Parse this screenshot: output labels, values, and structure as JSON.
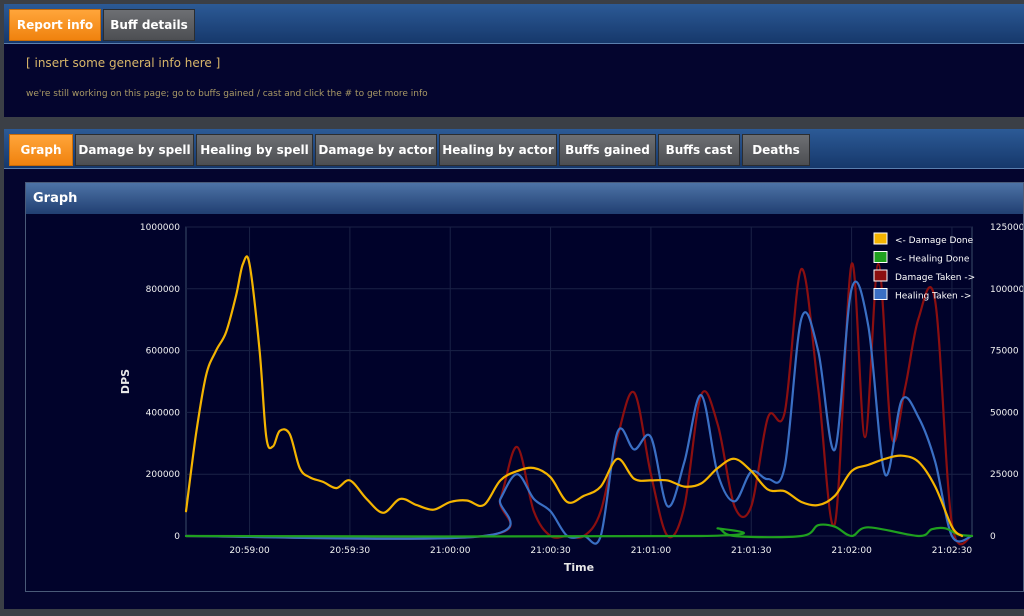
{
  "report_tabs": [
    "Report info",
    "Buff details"
  ],
  "info": {
    "title": "[ insert some general info here ]",
    "subtitle": "we're still working on this page; go to buffs gained / cast and click the # to get more info"
  },
  "section_tabs": [
    "Graph",
    "Damage by spell",
    "Healing by spell",
    "Damage by actor",
    "Healing by actor",
    "Buffs gained",
    "Buffs cast",
    "Deaths"
  ],
  "graph_panel": {
    "title": "Graph"
  },
  "colors": {
    "active_tab": "#f59118",
    "tab": "#5d5f63",
    "panel_bg": "#04052e",
    "header_blue": "#244a80"
  },
  "chart_data": {
    "type": "line",
    "xlabel": "Time",
    "ylabel": "DPS",
    "x_ticks": [
      "20:59:00",
      "20:59:30",
      "21:00:00",
      "21:00:30",
      "21:01:00",
      "21:01:30",
      "21:02:00",
      "21:02:30"
    ],
    "xlim": [
      "20:58:41",
      "21:02:36"
    ],
    "ylim_left": [
      0,
      1000000
    ],
    "ylim_right": [
      0,
      125000
    ],
    "y_ticks_left": [
      "0",
      "200000",
      "400000",
      "600000",
      "800000",
      "1000000"
    ],
    "y_ticks_right": [
      "0",
      "25000",
      "50000",
      "75000",
      "100000",
      "125000"
    ],
    "legend_position": "top-right",
    "grid": true,
    "series": [
      {
        "name": "<- Damage Done",
        "axis": "left",
        "color": "#f4b400",
        "x": [
          "20:58:41",
          "20:58:44",
          "20:58:47",
          "20:58:50",
          "20:58:53",
          "20:58:56",
          "20:58:58",
          "20:59:00",
          "20:59:03",
          "20:59:05",
          "20:59:07",
          "20:59:09",
          "20:59:12",
          "20:59:15",
          "20:59:18",
          "20:59:22",
          "20:59:26",
          "20:59:30",
          "20:59:35",
          "20:59:40",
          "20:59:45",
          "20:59:50",
          "20:59:55",
          "21:00:00",
          "21:00:05",
          "21:00:10",
          "21:00:15",
          "21:00:20",
          "21:00:25",
          "21:00:30",
          "21:00:35",
          "21:00:40",
          "21:00:45",
          "21:00:50",
          "21:00:55",
          "21:01:00",
          "21:01:05",
          "21:01:10",
          "21:01:15",
          "21:01:20",
          "21:01:25",
          "21:01:30",
          "21:01:35",
          "21:01:40",
          "21:01:45",
          "21:01:50",
          "21:01:55",
          "21:02:00",
          "21:02:05",
          "21:02:10",
          "21:02:15",
          "21:02:20",
          "21:02:25",
          "21:02:30",
          "21:02:33"
        ],
        "y": [
          80000,
          330000,
          520000,
          600000,
          660000,
          780000,
          880000,
          880000,
          600000,
          320000,
          290000,
          340000,
          330000,
          220000,
          190000,
          175000,
          155000,
          180000,
          120000,
          75000,
          120000,
          100000,
          85000,
          110000,
          115000,
          100000,
          180000,
          210000,
          220000,
          190000,
          110000,
          130000,
          160000,
          250000,
          185000,
          180000,
          180000,
          160000,
          170000,
          220000,
          250000,
          210000,
          150000,
          145000,
          110000,
          100000,
          130000,
          210000,
          230000,
          250000,
          260000,
          240000,
          160000,
          30000,
          0
        ]
      },
      {
        "name": "<- Healing Done",
        "axis": "left",
        "color": "#1fa01f",
        "x": [
          "20:58:41",
          "21:01:15",
          "21:01:20",
          "21:01:25",
          "21:01:45",
          "21:01:50",
          "21:01:55",
          "21:02:00",
          "21:02:05",
          "21:02:20",
          "21:02:24",
          "21:02:28",
          "21:02:32",
          "21:02:36"
        ],
        "y": [
          0,
          0,
          25000,
          0,
          0,
          35000,
          30000,
          0,
          28000,
          0,
          22000,
          25000,
          5000,
          0
        ]
      },
      {
        "name": "Damage Taken ->",
        "axis": "right",
        "color": "#8b0f10",
        "x": [
          "20:58:41",
          "21:00:10",
          "21:00:15",
          "21:00:20",
          "21:00:25",
          "21:00:30",
          "21:00:35",
          "21:00:40",
          "21:00:45",
          "21:00:50",
          "21:00:55",
          "21:01:00",
          "21:01:05",
          "21:01:10",
          "21:01:15",
          "21:01:20",
          "21:01:25",
          "21:01:30",
          "21:01:35",
          "21:01:40",
          "21:01:45",
          "21:01:50",
          "21:01:55",
          "21:02:00",
          "21:02:04",
          "21:02:08",
          "21:02:12",
          "21:02:16",
          "21:02:20",
          "21:02:25",
          "21:02:30",
          "21:02:36"
        ],
        "y": [
          0,
          0,
          15000,
          36000,
          10000,
          0,
          0,
          0,
          10000,
          40000,
          58000,
          25000,
          0,
          12000,
          57000,
          45000,
          12000,
          12000,
          48000,
          50000,
          108000,
          60000,
          5000,
          110000,
          40000,
          110000,
          40000,
          60000,
          88000,
          95000,
          5000,
          0
        ]
      },
      {
        "name": "Healing Taken ->",
        "axis": "right",
        "color": "#3a6fc4",
        "x": [
          "20:58:41",
          "21:00:10",
          "21:00:15",
          "21:00:20",
          "21:00:25",
          "21:00:30",
          "21:00:35",
          "21:00:40",
          "21:00:45",
          "21:00:50",
          "21:00:55",
          "21:01:00",
          "21:01:05",
          "21:01:10",
          "21:01:15",
          "21:01:20",
          "21:01:25",
          "21:01:30",
          "21:01:35",
          "21:01:40",
          "21:01:45",
          "21:01:50",
          "21:01:55",
          "21:02:00",
          "21:02:05",
          "21:02:10",
          "21:02:15",
          "21:02:20",
          "21:02:25",
          "21:02:30",
          "21:02:36"
        ],
        "y": [
          0,
          0,
          15000,
          25000,
          15000,
          10000,
          0,
          0,
          0,
          42000,
          35000,
          40000,
          12000,
          30000,
          57000,
          25000,
          14000,
          26000,
          23000,
          28000,
          88000,
          75000,
          35000,
          100000,
          85000,
          25000,
          55000,
          48000,
          30000,
          0,
          0
        ]
      }
    ]
  }
}
